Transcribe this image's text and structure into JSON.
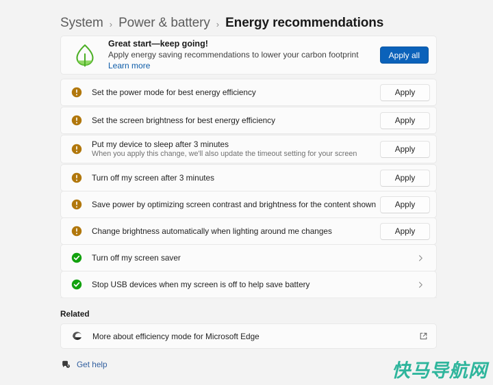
{
  "breadcrumb": {
    "items": [
      {
        "label": "System",
        "current": false
      },
      {
        "label": "Power & battery",
        "current": false
      },
      {
        "label": "Energy recommendations",
        "current": true
      }
    ],
    "separator": "›"
  },
  "banner": {
    "icon": "leaf-icon",
    "title": "Great start—keep going!",
    "description": "Apply energy saving recommendations to lower your carbon footprint",
    "link_label": "Learn more",
    "button_label": "Apply all",
    "accent_color": "#0b62ba"
  },
  "recommendations": [
    {
      "status": "warning",
      "status_icon": "warning-circle-icon",
      "title": "Set the power mode for best energy efficiency",
      "subtitle": "",
      "action": "Apply",
      "action_type": "button"
    },
    {
      "status": "warning",
      "status_icon": "warning-circle-icon",
      "title": "Set the screen brightness for best energy efficiency",
      "subtitle": "",
      "action": "Apply",
      "action_type": "button"
    },
    {
      "status": "warning",
      "status_icon": "warning-circle-icon",
      "title": "Put my device to sleep after 3 minutes",
      "subtitle": "When you apply this change, we'll also update the timeout setting for your screen",
      "action": "Apply",
      "action_type": "button"
    },
    {
      "status": "warning",
      "status_icon": "warning-circle-icon",
      "title": "Turn off my screen after 3 minutes",
      "subtitle": "",
      "action": "Apply",
      "action_type": "button"
    },
    {
      "status": "warning",
      "status_icon": "warning-circle-icon",
      "title": "Save power by optimizing screen contrast and brightness for the content shown",
      "subtitle": "",
      "action": "Apply",
      "action_type": "button"
    },
    {
      "status": "warning",
      "status_icon": "warning-circle-icon",
      "title": "Change brightness automatically when lighting around me changes",
      "subtitle": "",
      "action": "Apply",
      "action_type": "button"
    },
    {
      "status": "done",
      "status_icon": "check-circle-icon",
      "title": "Turn off my screen saver",
      "subtitle": "",
      "action": "",
      "action_type": "chevron"
    },
    {
      "status": "done",
      "status_icon": "check-circle-icon",
      "title": "Stop USB devices when my screen is off to help save battery",
      "subtitle": "",
      "action": "",
      "action_type": "chevron"
    }
  ],
  "related": {
    "heading": "Related",
    "item_label": "More about efficiency mode for Microsoft Edge",
    "item_icon": "edge-browser-icon",
    "trailing_icon": "external-link-icon"
  },
  "footer": {
    "get_help_label": "Get help",
    "get_help_icon": "help-question-icon"
  },
  "watermark": {
    "text": "快马导航网",
    "color": "#2eb59c"
  },
  "colors": {
    "page_background": "#f3f3f3",
    "card_background": "#fbfbfb",
    "warning": "#b8860b",
    "success": "#13a10e",
    "accent": "#0b62ba",
    "link": "#0b5ba8"
  }
}
